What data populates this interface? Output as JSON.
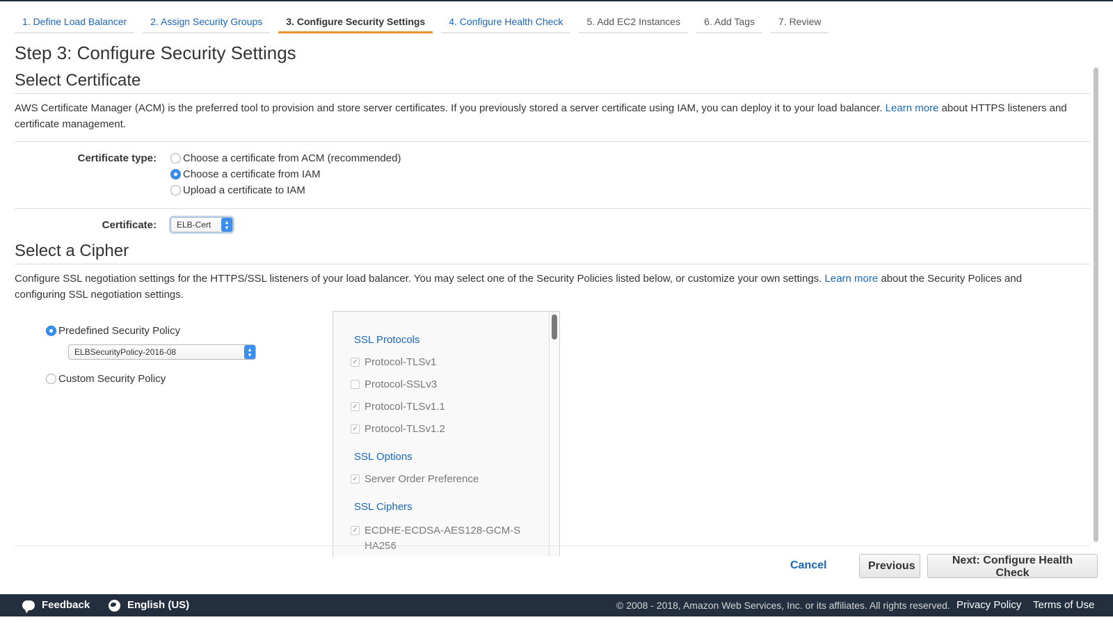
{
  "wizard": {
    "tabs": [
      {
        "label": "1. Define Load Balancer"
      },
      {
        "label": "2. Assign Security Groups"
      },
      {
        "label": "3. Configure Security Settings"
      },
      {
        "label": "4. Configure Health Check"
      },
      {
        "label": "5. Add EC2 Instances"
      },
      {
        "label": "6. Add Tags"
      },
      {
        "label": "7. Review"
      }
    ],
    "active_index": 2
  },
  "page_title": "Step 3: Configure Security Settings",
  "certificate": {
    "heading": "Select Certificate",
    "desc_before_link": "AWS Certificate Manager (ACM) is the preferred tool to provision and store server certificates. If you previously stored a server certificate using IAM, you can deploy it to your load balancer.",
    "link": "Learn more",
    "desc_after_link": "about HTTPS listeners and certificate management.",
    "type_label": "Certificate type:",
    "options": [
      {
        "label": "Choose a certificate from ACM (recommended)",
        "selected": false
      },
      {
        "label": "Choose a certificate from IAM",
        "selected": true
      },
      {
        "label": "Upload a certificate to IAM",
        "selected": false
      }
    ],
    "cert_label": "Certificate:",
    "cert_value": "ELB-Cert"
  },
  "cipher": {
    "heading": "Select a Cipher",
    "desc_before_link": "Configure SSL negotiation settings for the HTTPS/SSL listeners of your load balancer. You may select one of the Security Policies listed below, or customize your own settings.",
    "link": "Learn more",
    "desc_after_link": "about the Security Polices and configuring SSL negotiation settings.",
    "predefined_label": "Predefined Security Policy",
    "predefined_selected": true,
    "policy_value": "ELBSecurityPolicy-2016-08",
    "custom_label": "Custom Security Policy",
    "groups": {
      "protocols": {
        "title": "SSL Protocols",
        "items": [
          {
            "label": "Protocol-TLSv1",
            "checked": true
          },
          {
            "label": "Protocol-SSLv3",
            "checked": false
          },
          {
            "label": "Protocol-TLSv1.1",
            "checked": true
          },
          {
            "label": "Protocol-TLSv1.2",
            "checked": true
          }
        ]
      },
      "options": {
        "title": "SSL Options",
        "items": [
          {
            "label": "Server Order Preference",
            "checked": true
          }
        ]
      },
      "ciphers": {
        "title": "SSL Ciphers",
        "items": [
          {
            "label": "ECDHE-ECDSA-AES128-GCM-SHA256",
            "checked": true
          }
        ]
      }
    }
  },
  "actions": {
    "cancel": "Cancel",
    "previous": "Previous",
    "next": "Next: Configure Health Check"
  },
  "footer": {
    "feedback": "Feedback",
    "language": "English (US)",
    "copyright": "© 2008 - 2018, Amazon Web Services, Inc. or its affiliates. All rights reserved.",
    "privacy": "Privacy Policy",
    "terms": "Terms of Use"
  },
  "colors": {
    "link": "#1a66b8",
    "active_tab_accent": "#ec8f2e",
    "footer_bg": "#232f3e",
    "radio_selected": "#3b8ff0"
  }
}
